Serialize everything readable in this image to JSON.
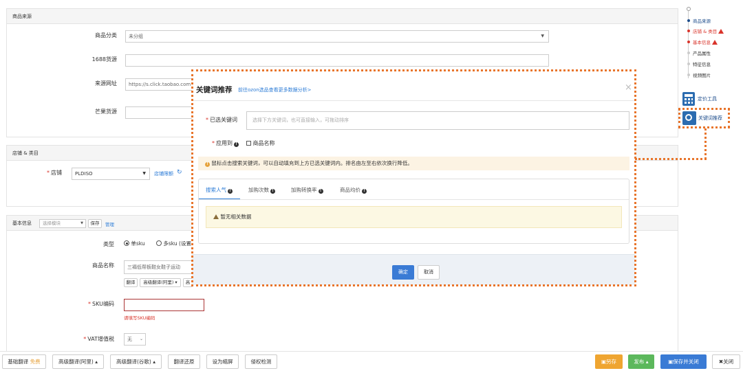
{
  "source_panel": {
    "title": "商品来源",
    "category_label": "商品分类",
    "category_value": "未分组",
    "src1688_label": "1688货源",
    "url_label": "来源网址",
    "url_value": "https://s.click.taobao.com",
    "mango_label": "芒果货源"
  },
  "store_panel": {
    "title": "店铺 & 类目",
    "store_label": "店铺",
    "store_value": "PLDISO",
    "store_limit_link": "店铺限额"
  },
  "basic_panel": {
    "title": "基本信息",
    "template_placeholder": "选择模块",
    "save_label": "保存",
    "manage_label": "管理",
    "type_label": "类型",
    "single_sku": "单sku",
    "multi_sku": "多sku (设置",
    "name_label": "商品名称",
    "name_value": "三褟低帮板鞋女鞋子运动",
    "translate_btn": "翻译",
    "adv_translate_btn": "高级翻译(阿里)",
    "more_btn": "高",
    "sku_label": "SKU编码",
    "sku_error": "请填写SKU编码",
    "vat_label": "VAT增值税",
    "vat_value": "无"
  },
  "timeline": {
    "items": [
      {
        "label": "商品来源"
      },
      {
        "label": "店铺 & 类目"
      },
      {
        "label": "基本信息"
      },
      {
        "label": "产品属性"
      },
      {
        "label": "特征信息"
      },
      {
        "label": "视频图片"
      }
    ],
    "pricing_tool": "定价工具",
    "keyword_recommend": "关键词推荐"
  },
  "modal": {
    "title": "关键词推荐",
    "subtitle_link": "前往ozon选品查看更多数据分析>",
    "selected_label": "已选关键词",
    "selected_placeholder": "选择下方关键词，也可直接输入，可拖动排序",
    "apply_label": "应用到",
    "apply_option": "商品名称",
    "notice": "鼠标点击搜索关键词，可以自动填充到上方已选关键词内。排名由左至右依次换行降低。",
    "tabs": [
      {
        "label": "搜索人气"
      },
      {
        "label": "加购次数"
      },
      {
        "label": "加购转换率"
      },
      {
        "label": "商品均价"
      }
    ],
    "empty_text": "暂无相关数据",
    "ok_label": "确定",
    "cancel_label": "取消",
    "close_glyph": "×"
  },
  "bottom_bar": {
    "basic_translate": "基础翻译",
    "free_tag": "免费",
    "adv_ali": "高级翻译(阿里)",
    "adv_google": "高级翻译(谷歌)",
    "restore": "翻译还原",
    "set_cover": "设为缩屏",
    "infringe": "侵权检测",
    "save_as": "另存",
    "publish": "发布",
    "save_close": "保存并关闭",
    "close": "关闭"
  }
}
